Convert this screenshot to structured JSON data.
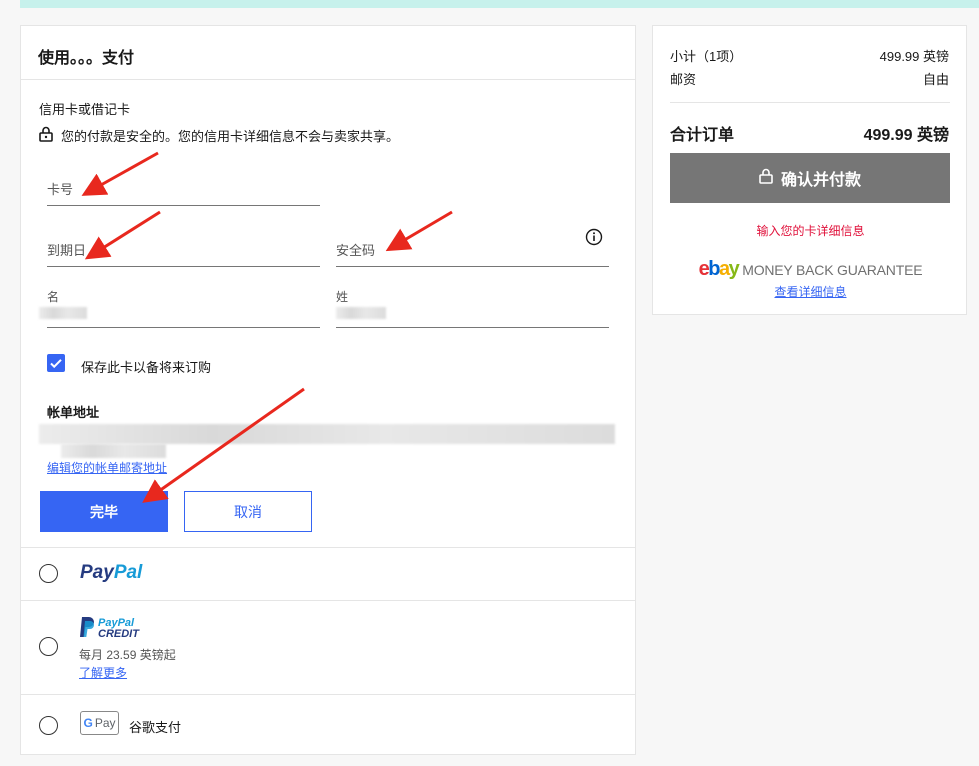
{
  "payment": {
    "title": "使用。。。支付",
    "card_section_label": "信用卡或借记卡",
    "secure_note": "您的付款是安全的。您的信用卡详细信息不会与卖家共享。",
    "fields": {
      "card_number": "卡号",
      "expiry": "到期日",
      "security_code": "安全码",
      "first_name": "名",
      "last_name": "姓"
    },
    "save_card_label": "保存此卡以备将来订购",
    "billing_address_title": "帐单地址",
    "edit_billing_link": "编辑您的帐单邮寄地址",
    "done_button": "完毕",
    "cancel_button": "取消",
    "options": {
      "paypal_1": "Pay",
      "paypal_2": "Pal",
      "credit_1": "PayPal",
      "credit_2": "CREDIT",
      "credit_monthly": "每月 23.59 英镑起",
      "credit_learn_more": "了解更多",
      "gpay_label": "Pay",
      "gpay_g": "G",
      "google_pay": "谷歌支付"
    }
  },
  "summary": {
    "subtotal_label": "小计（1项）",
    "subtotal_value": "499.99 英镑",
    "postage_label": "邮资",
    "postage_value": "自由",
    "total_label": "合计订单",
    "total_value": "499.99 英镑",
    "confirm_button": "确认并付款",
    "error_message": "输入您的卡详细信息",
    "guarantee_ebay": "ebay",
    "guarantee_text": "MONEY BACK GUARANTEE",
    "guarantee_link": "查看详细信息"
  },
  "colors": {
    "accent": "#3665f3",
    "error": "#e0103a",
    "arrow": "#e8281e"
  }
}
